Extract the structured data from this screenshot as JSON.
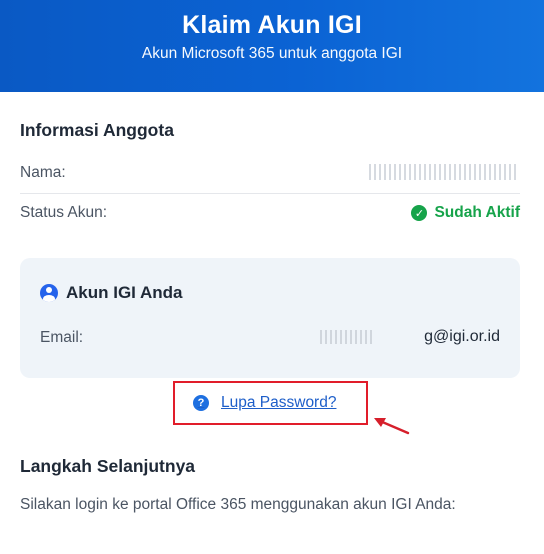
{
  "header": {
    "title": "Klaim Akun IGI",
    "subtitle": "Akun Microsoft 365 untuk anggota IGI"
  },
  "member_info": {
    "title": "Informasi Anggota",
    "name_label": "Nama:",
    "name_value": "Anlim...UAR",
    "status_label": "Status Akun:",
    "status_value": "Sudah Aktif",
    "status_icon": "check-circle-icon",
    "status_color": "#16a34a"
  },
  "account": {
    "title": "Akun IGI Anda",
    "icon": "user-circle-icon",
    "email_label": "Email:",
    "email_value": "g@igi.or.id"
  },
  "forgot": {
    "label": "Lupa Password?",
    "icon": "question-circle-icon",
    "highlight_color": "#e11d2a"
  },
  "next_steps": {
    "title": "Langkah Selanjutnya",
    "text": "Silakan login ke portal Office 365 menggunakan akun IGI Anda:"
  },
  "colors": {
    "header_blue": "#0b63d4",
    "link_blue": "#1d5ec9",
    "card_bg": "#eff4f9"
  }
}
